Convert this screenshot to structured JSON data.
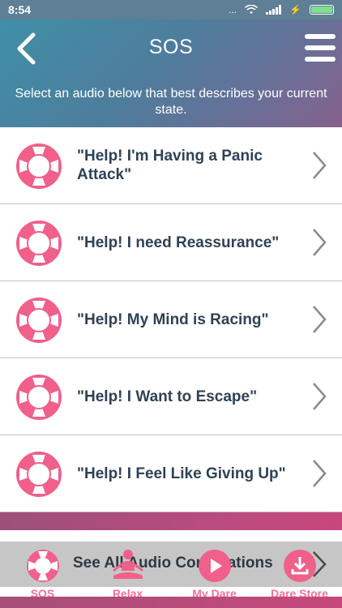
{
  "status": {
    "time": "8:54",
    "signal_dots": "...",
    "charging_glyph": "⚡"
  },
  "header": {
    "title": "SOS",
    "subtitle": "Select an audio below that best describes your current state.",
    "back_icon": "chevron-left-icon",
    "menu_icon": "hamburger-menu-icon"
  },
  "items": [
    {
      "label": "\"Help! I'm Having a Panic Attack\"",
      "icon": "lifebuoy-icon"
    },
    {
      "label": "\"Help! I need Reassurance\"",
      "icon": "lifebuoy-icon"
    },
    {
      "label": "\"Help! My Mind is Racing\"",
      "icon": "lifebuoy-icon"
    },
    {
      "label": "\"Help! I Want to Escape\"",
      "icon": "lifebuoy-icon"
    },
    {
      "label": "\"Help! I Feel Like Giving Up\"",
      "icon": "lifebuoy-icon"
    }
  ],
  "see_all": {
    "label": "See All Audio Compilations"
  },
  "tabs": [
    {
      "label": "SOS",
      "icon": "lifebuoy-icon"
    },
    {
      "label": "Relax",
      "icon": "meditation-icon"
    },
    {
      "label": "My Dare",
      "icon": "play-icon"
    },
    {
      "label": "Dare Store",
      "icon": "download-icon"
    }
  ],
  "colors": {
    "accent": "#f0608a",
    "header_start": "#3f8fa8",
    "header_end": "#86618b",
    "text_dark": "#2f4256"
  }
}
